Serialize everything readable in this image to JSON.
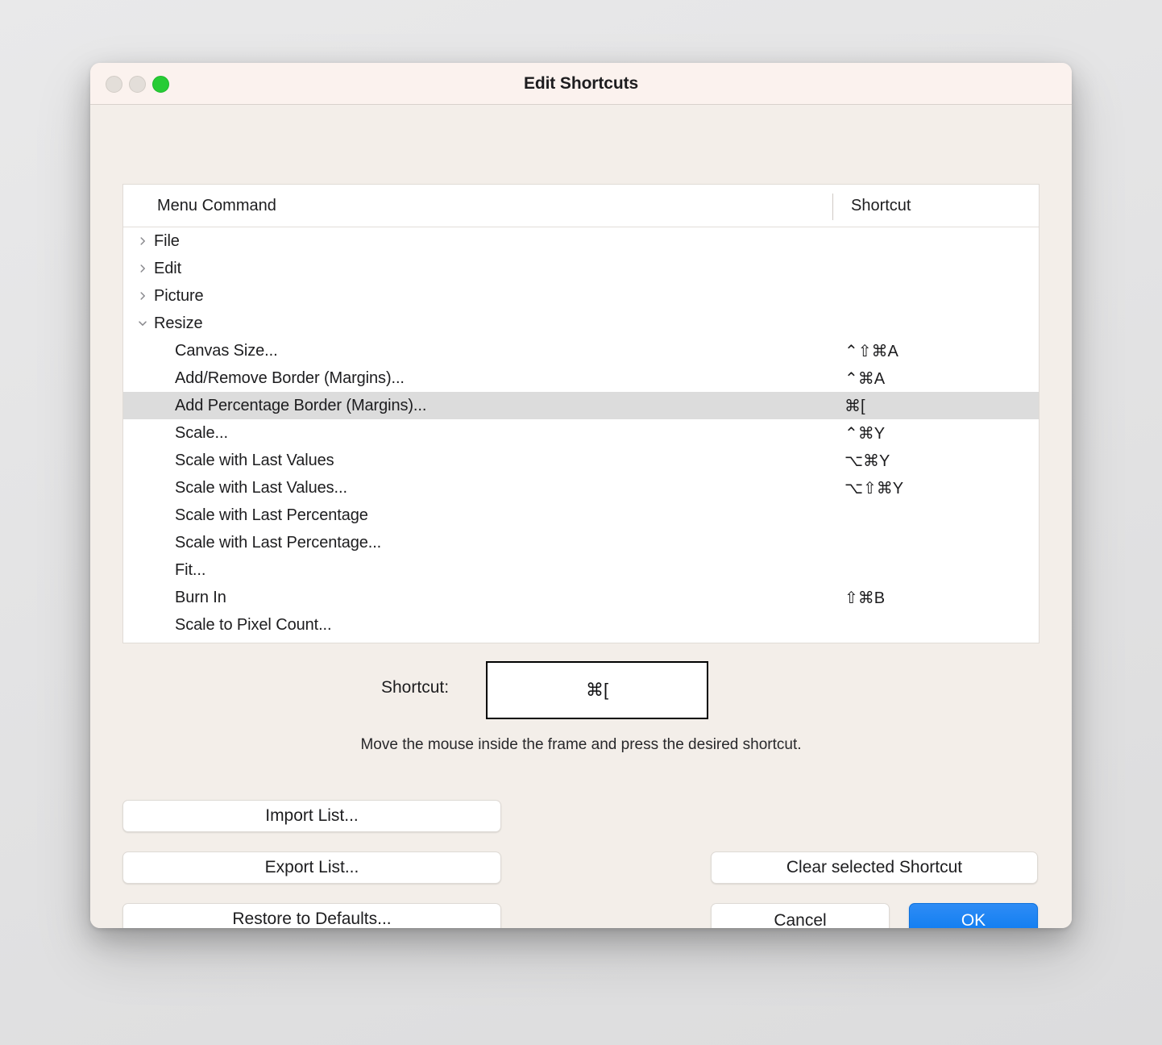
{
  "window": {
    "title": "Edit Shortcuts",
    "traffic_lights": [
      {
        "name": "close",
        "color": "#e3ded9",
        "enabled": false
      },
      {
        "name": "minimize",
        "color": "#e3ded9",
        "enabled": false
      },
      {
        "name": "zoom",
        "color": "#26cc35",
        "enabled": true
      }
    ]
  },
  "table": {
    "columns": {
      "menu_command": "Menu Command",
      "shortcut": "Shortcut"
    },
    "rows": [
      {
        "type": "group",
        "label": "File",
        "expanded": false,
        "shortcut": ""
      },
      {
        "type": "group",
        "label": "Edit",
        "expanded": false,
        "shortcut": ""
      },
      {
        "type": "group",
        "label": "Picture",
        "expanded": false,
        "shortcut": ""
      },
      {
        "type": "group",
        "label": "Resize",
        "expanded": true,
        "shortcut": ""
      },
      {
        "type": "item",
        "label": "Canvas Size...",
        "shortcut": "⌃⇧⌘A",
        "selected": false
      },
      {
        "type": "item",
        "label": "Add/Remove Border (Margins)...",
        "shortcut": "⌃⌘A",
        "selected": false
      },
      {
        "type": "item",
        "label": "Add Percentage Border (Margins)...",
        "shortcut": "⌘[",
        "selected": true
      },
      {
        "type": "item",
        "label": "Scale...",
        "shortcut": "⌃⌘Y",
        "selected": false
      },
      {
        "type": "item",
        "label": "Scale with Last Values",
        "shortcut": "⌥⌘Y",
        "selected": false
      },
      {
        "type": "item",
        "label": "Scale with Last Values...",
        "shortcut": "⌥⇧⌘Y",
        "selected": false
      },
      {
        "type": "item",
        "label": "Scale with Last Percentage",
        "shortcut": "",
        "selected": false
      },
      {
        "type": "item",
        "label": "Scale with Last Percentage...",
        "shortcut": "",
        "selected": false
      },
      {
        "type": "item",
        "label": "Fit...",
        "shortcut": "",
        "selected": false
      },
      {
        "type": "item",
        "label": "Burn In",
        "shortcut": "⇧⌘B",
        "selected": false
      },
      {
        "type": "item",
        "label": "Scale to Pixel Count...",
        "shortcut": "",
        "selected": false
      }
    ]
  },
  "shortcut_editor": {
    "label": "Shortcut:",
    "value": "⌘[",
    "hint": "Move the mouse inside the frame and press the desired shortcut."
  },
  "buttons": {
    "import_list": "Import List...",
    "export_list": "Export List...",
    "restore_defaults": "Restore to Defaults...",
    "clear_selected": "Clear selected Shortcut",
    "cancel": "Cancel",
    "ok": "OK"
  },
  "colors": {
    "window_background": "#f3eee9",
    "titlebar_background": "#fbf2ee",
    "selection": "#dcdcdc",
    "accent_blue": "#0a7af0",
    "zoom_green": "#26cc35"
  }
}
